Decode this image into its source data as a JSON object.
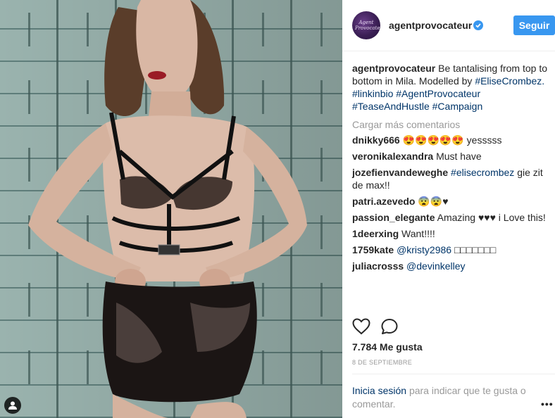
{
  "post": {
    "author": "agentprovocateur",
    "avatar_text": "Agent Provocateur",
    "follow_label": "Seguir",
    "caption": {
      "username": "agentprovocateur",
      "text": "Be tantalising from top to bottom in Mila. Modelled by",
      "mention": "#EliseCrombez.",
      "tags": [
        "#linkinbio",
        "#AgentProvocateur",
        "#TeaseAndHustle",
        "#Campaign"
      ]
    },
    "load_more": "Cargar más comentarios",
    "comments": [
      {
        "user": "dnikky666",
        "text": "😍😍😍😍😍 yesssss"
      },
      {
        "user": "veronikalexandra",
        "text": "Must have"
      },
      {
        "user": "jozefienvandeweghe",
        "link": "#elisecrombez",
        "text": "gie zit de max!!"
      },
      {
        "user": "patri.azevedo",
        "text": "😨😨♥"
      },
      {
        "user": "passion_elegante",
        "text": "Amazing ♥♥♥ i Love this!"
      },
      {
        "user": "1deerxing",
        "text": "Want!!!!"
      },
      {
        "user": "1759kate",
        "link": "@kristy2986",
        "text": "□□□□□□□"
      },
      {
        "user": "juliacrosss",
        "link": "@devinkelley",
        "text": ""
      }
    ],
    "likes": "7.784 Me gusta",
    "date": "8 DE SEPTIEMBRE",
    "login_link": "Inicia sesión",
    "login_text": "para indicar que te gusta o comentar.",
    "more_label": "•••"
  },
  "colors": {
    "accent": "#3897f0",
    "link": "#003569",
    "muted": "#999999"
  },
  "icons": [
    "user-tag-icon",
    "verified-badge-icon",
    "heart-icon",
    "comment-bubble-icon"
  ]
}
